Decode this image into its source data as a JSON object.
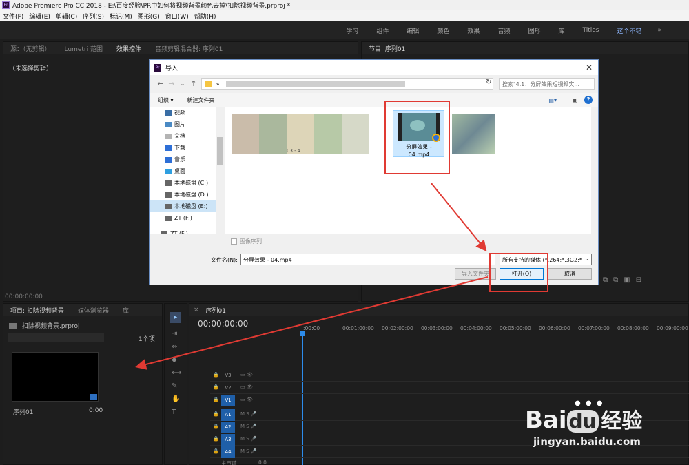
{
  "app": {
    "title": "Adobe Premiere Pro CC 2018 - E:\\百度经验\\PR中如何将视频背景颜色去掉\\扣除视频背景.prproj *"
  },
  "menu": [
    "文件(F)",
    "编辑(E)",
    "剪辑(C)",
    "序列(S)",
    "标记(M)",
    "图形(G)",
    "窗口(W)",
    "帮助(H)"
  ],
  "workspaces": [
    "学习",
    "组件",
    "编辑",
    "颜色",
    "效果",
    "音频",
    "图形",
    "库",
    "Titles",
    "这个不错"
  ],
  "source_panel": {
    "tabs": [
      "源：（无剪辑）",
      "Lumetri 范围",
      "效果控件",
      "音频剪辑混合器: 序列01"
    ],
    "content": "（未选择剪辑）",
    "timecode": "00:00:00:00"
  },
  "program_panel": {
    "tab": "节目: 序列01"
  },
  "project_panel": {
    "tabs": [
      "项目: 扣除视频背景",
      "媒体浏览器",
      "库"
    ],
    "file": "扣除视频背景.prproj",
    "count": "1个项",
    "clip_name": "序列01",
    "clip_duration": "0:00"
  },
  "timeline": {
    "tab": "序列01",
    "timecode": "00:00:00:00",
    "ruler": [
      ":00:00",
      "00:01:00:00",
      "00:02:00:00",
      "00:03:00:00",
      "00:04:00:00",
      "00:05:00:00",
      "00:06:00:00",
      "00:07:00:00",
      "00:08:00:00",
      "00:09:00:00"
    ],
    "video_tracks": [
      "V3",
      "V2",
      "V1"
    ],
    "audio_tracks": [
      "A1",
      "A2",
      "A3",
      "A4"
    ],
    "master": "主声道",
    "master_val": "0.0"
  },
  "dialog": {
    "title": "导入",
    "address": "«",
    "search_placeholder": "搜索\"4.1：分屏效果短视频实...",
    "organize": "组织 ▾",
    "new_folder": "新建文件夹",
    "nav": [
      "视频",
      "图片",
      "文档",
      "下载",
      "音乐",
      "桌面",
      "本地磁盘 (C:)",
      "本地磁盘 (D:)",
      "本地磁盘 (E:)",
      "ZT (F:)",
      "ZT (F:)"
    ],
    "selected_file": "分屏效果 - 04.mp4",
    "partial_label": "03 - 4...",
    "image_sequence": "图像序列",
    "filename_label": "文件名(N):",
    "filename_value": "分屏效果 - 04.mp4",
    "filter": "所有支持的媒体 (*.264;*.3G2;*",
    "import_folder": "导入文件夹",
    "open": "打开(O)",
    "cancel": "取消"
  },
  "watermark": {
    "brand": "Bai",
    "brand2": "du",
    "brand_cn": "经验",
    "url": "jingyan.baidu.com"
  },
  "colors": {
    "accent": "#2d8ceb",
    "red": "#e03a33",
    "bg": "#1d1d1d"
  }
}
